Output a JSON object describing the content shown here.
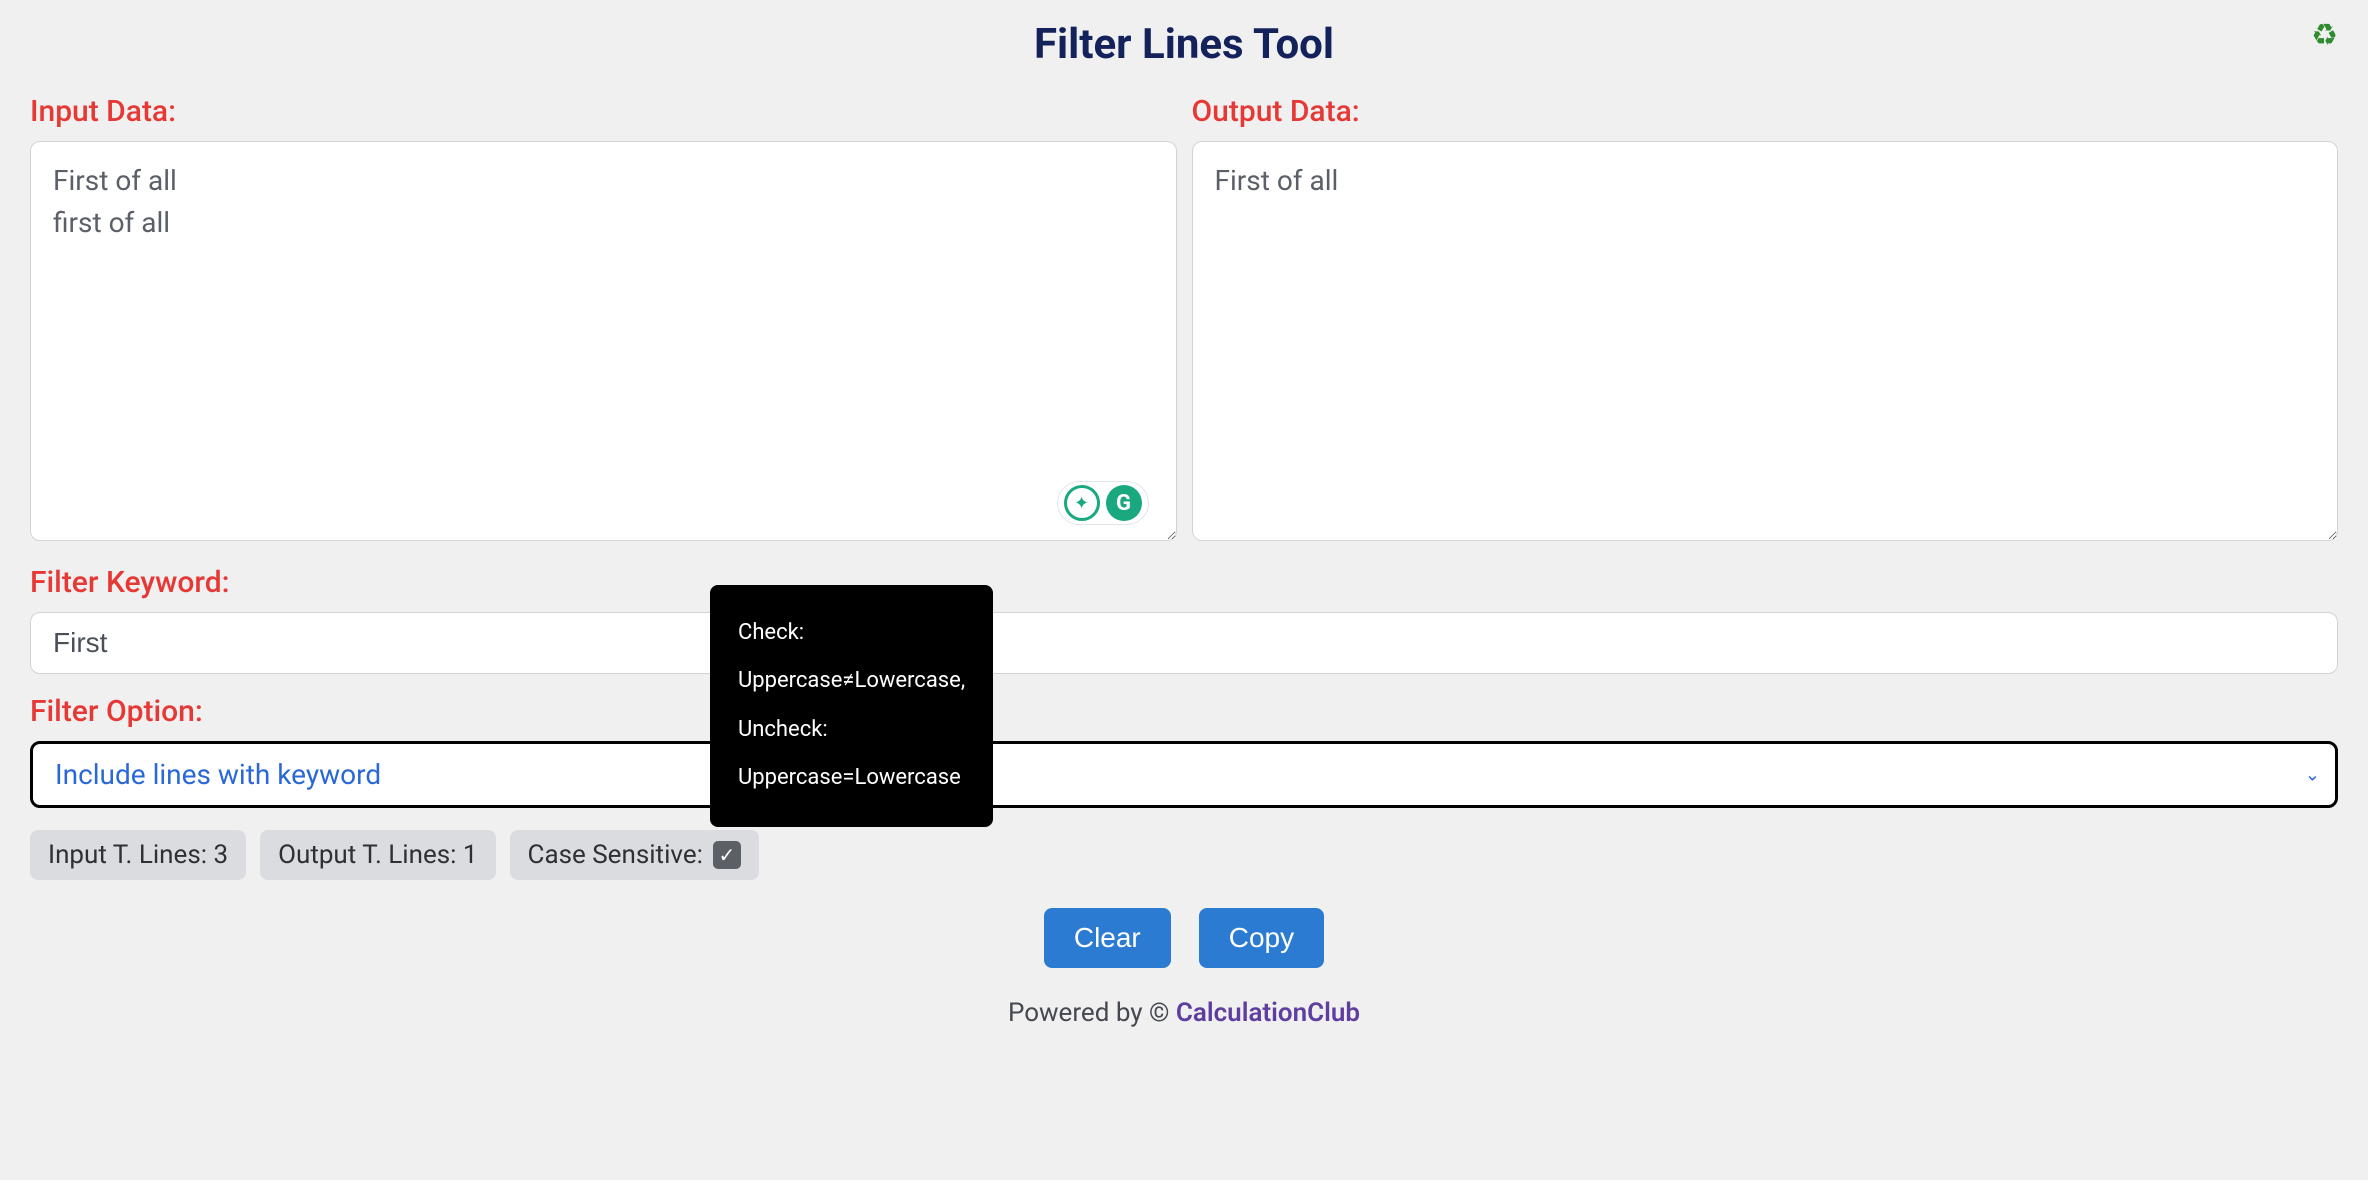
{
  "title": "Filter Lines Tool",
  "labels": {
    "input": "Input Data:",
    "output": "Output Data:",
    "keyword": "Filter Keyword:",
    "option": "Filter Option:"
  },
  "input_text": "First of all\nfirst of all",
  "output_text": "First of all",
  "keyword_value": "First",
  "filter_option": "Include lines with keyword",
  "badges": {
    "input_lines": "Input T. Lines: 3",
    "output_lines": "Output T. Lines: 1",
    "case_sensitive": "Case Sensitive:"
  },
  "case_sensitive_checked": true,
  "tooltip": "Check:\nUppercase≠Lowercase,\nUncheck:\nUppercase=Lowercase",
  "buttons": {
    "clear": "Clear",
    "copy": "Copy"
  },
  "footer": {
    "powered": "Powered by © ",
    "brand": "CalculationClub"
  }
}
